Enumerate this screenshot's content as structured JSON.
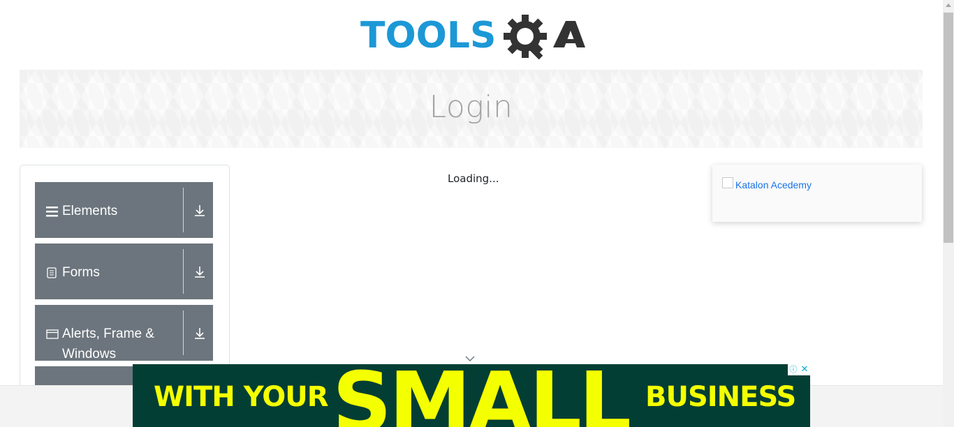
{
  "logo": {
    "word1": "TOOLS",
    "word2": "QA",
    "color_primary": "#1c98d6",
    "color_secondary": "#333333"
  },
  "banner": {
    "title": "Login"
  },
  "sidebar": {
    "groups": [
      {
        "label": "Elements",
        "icon": "hamburger-icon"
      },
      {
        "label": "Forms",
        "icon": "document-icon"
      },
      {
        "label": "Alerts, Frame & Windows",
        "icon": "window-icon"
      }
    ]
  },
  "main": {
    "loading_text": "Loading..."
  },
  "ad_card": {
    "alt_text": "Katalon Acedemy"
  },
  "bottom_ad": {
    "text_left": "WITH YOUR",
    "text_center": "SMALL",
    "text_right": "BUSINESS",
    "bg_color": "#033e34",
    "text_color": "#f4ff00",
    "info_glyph": "ⓘ",
    "close_glyph": "✕"
  }
}
